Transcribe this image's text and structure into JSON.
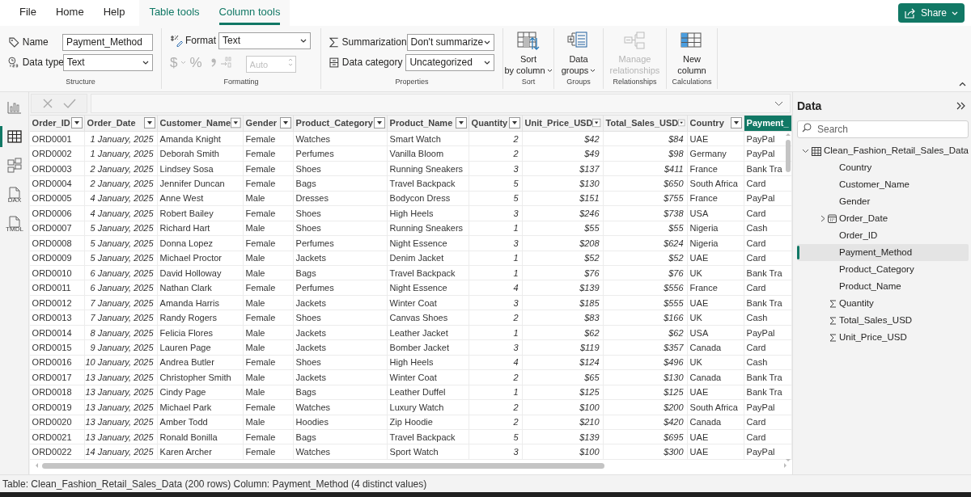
{
  "menu_tabs": [
    {
      "label": "File",
      "selected": false,
      "contextual": false
    },
    {
      "label": "Home",
      "selected": false,
      "contextual": false
    },
    {
      "label": "Help",
      "selected": false,
      "contextual": false
    },
    {
      "label": "Table tools",
      "selected": false,
      "contextual": true
    },
    {
      "label": "Column tools",
      "selected": true,
      "contextual": true
    }
  ],
  "share_button": "Share",
  "structure": {
    "name_label": "Name",
    "name_value": "Payment_Method",
    "data_type_label": "Data type",
    "data_type_value": "Text",
    "group_label": "Structure"
  },
  "formatting": {
    "format_label": "Format",
    "format_value": "Text",
    "currency_symbol": "$",
    "percent_symbol": "%",
    "decimal_placeholder": "Auto",
    "disabled": true,
    "group_label": "Formatting"
  },
  "properties": {
    "summarization_label": "Summarization",
    "summarization_value": "Don't summarize",
    "category_label": "Data category",
    "category_value": "Uncategorized",
    "group_label": "Properties"
  },
  "ribbon_buttons": [
    {
      "kind": "sort",
      "label": "Sort by column",
      "dropdown": true,
      "disabled": false,
      "group_label": "Sort"
    },
    {
      "kind": "groups",
      "label": "Data groups",
      "dropdown": true,
      "disabled": false,
      "group_label": "Groups"
    },
    {
      "kind": "relationships",
      "label": "Manage relationships",
      "dropdown": false,
      "disabled": true,
      "group_label": "Relationships"
    },
    {
      "kind": "new_column",
      "label": "New column",
      "dropdown": false,
      "disabled": false,
      "group_label": "Calculations"
    }
  ],
  "nav": [
    {
      "kind": "report",
      "selected": false
    },
    {
      "kind": "table",
      "selected": true
    },
    {
      "kind": "model",
      "selected": false
    },
    {
      "kind": "dax",
      "badge": "DAX",
      "selected": false
    },
    {
      "kind": "tmdl",
      "badge": "TMDL",
      "selected": false
    }
  ],
  "table": {
    "columns": [
      {
        "name": "Order_ID",
        "kind": "text",
        "selected": false,
        "filter": true
      },
      {
        "name": "Order_Date",
        "kind": "date",
        "selected": false,
        "filter": true
      },
      {
        "name": "Customer_Name",
        "kind": "text",
        "selected": false,
        "filter": true
      },
      {
        "name": "Gender",
        "kind": "text",
        "selected": false,
        "filter": true
      },
      {
        "name": "Product_Category",
        "kind": "text",
        "selected": false,
        "filter": true
      },
      {
        "name": "Product_Name",
        "kind": "text",
        "selected": false,
        "filter": true
      },
      {
        "name": "Quantity",
        "kind": "number",
        "selected": false,
        "filter": true
      },
      {
        "name": "Unit_Price_USD",
        "kind": "number",
        "selected": false,
        "filter": true
      },
      {
        "name": "Total_Sales_USD",
        "kind": "number",
        "selected": false,
        "filter": true
      },
      {
        "name": "Country",
        "kind": "text",
        "selected": false,
        "filter": true
      },
      {
        "name": "Payment_",
        "kind": "text",
        "selected": true,
        "filter": false
      }
    ],
    "rows": [
      [
        "ORD0001",
        "1 January, 2025",
        "Amanda Knight",
        "Female",
        "Watches",
        "Smart Watch",
        "2",
        "$42",
        "$84",
        "UAE",
        "PayPal"
      ],
      [
        "ORD0002",
        "1 January, 2025",
        "Deborah Smith",
        "Female",
        "Perfumes",
        "Vanilla Bloom",
        "2",
        "$49",
        "$98",
        "Germany",
        "PayPal"
      ],
      [
        "ORD0003",
        "2 January, 2025",
        "Lindsey Sosa",
        "Female",
        "Shoes",
        "Running Sneakers",
        "3",
        "$137",
        "$411",
        "France",
        "Bank Tra"
      ],
      [
        "ORD0004",
        "2 January, 2025",
        "Jennifer Duncan",
        "Female",
        "Bags",
        "Travel Backpack",
        "5",
        "$130",
        "$650",
        "South Africa",
        "Card"
      ],
      [
        "ORD0005",
        "4 January, 2025",
        "Anne West",
        "Male",
        "Dresses",
        "Bodycon Dress",
        "5",
        "$151",
        "$755",
        "France",
        "PayPal"
      ],
      [
        "ORD0006",
        "4 January, 2025",
        "Robert Bailey",
        "Female",
        "Shoes",
        "High Heels",
        "3",
        "$246",
        "$738",
        "USA",
        "Card"
      ],
      [
        "ORD0007",
        "5 January, 2025",
        "Richard Hart",
        "Male",
        "Shoes",
        "Running Sneakers",
        "1",
        "$55",
        "$55",
        "Nigeria",
        "Cash"
      ],
      [
        "ORD0008",
        "5 January, 2025",
        "Donna Lopez",
        "Female",
        "Perfumes",
        "Night Essence",
        "3",
        "$208",
        "$624",
        "Nigeria",
        "Card"
      ],
      [
        "ORD0009",
        "5 January, 2025",
        "Michael Proctor",
        "Male",
        "Jackets",
        "Denim Jacket",
        "1",
        "$52",
        "$52",
        "UAE",
        "Card"
      ],
      [
        "ORD0010",
        "6 January, 2025",
        "David Holloway",
        "Male",
        "Bags",
        "Travel Backpack",
        "1",
        "$76",
        "$76",
        "UK",
        "Bank Tra"
      ],
      [
        "ORD0011",
        "6 January, 2025",
        "Nathan Clark",
        "Female",
        "Perfumes",
        "Night Essence",
        "4",
        "$139",
        "$556",
        "France",
        "Card"
      ],
      [
        "ORD0012",
        "7 January, 2025",
        "Amanda Harris",
        "Male",
        "Jackets",
        "Winter Coat",
        "3",
        "$185",
        "$555",
        "UAE",
        "Bank Tra"
      ],
      [
        "ORD0013",
        "7 January, 2025",
        "Randy Rogers",
        "Female",
        "Shoes",
        "Canvas Shoes",
        "2",
        "$83",
        "$166",
        "UK",
        "Cash"
      ],
      [
        "ORD0014",
        "8 January, 2025",
        "Felicia Flores",
        "Male",
        "Jackets",
        "Leather Jacket",
        "1",
        "$62",
        "$62",
        "USA",
        "PayPal"
      ],
      [
        "ORD0015",
        "9 January, 2025",
        "Lauren Page",
        "Male",
        "Jackets",
        "Bomber Jacket",
        "3",
        "$119",
        "$357",
        "Canada",
        "Card"
      ],
      [
        "ORD0016",
        "10 January, 2025",
        "Andrea Butler",
        "Female",
        "Shoes",
        "High Heels",
        "4",
        "$124",
        "$496",
        "UK",
        "Cash"
      ],
      [
        "ORD0017",
        "13 January, 2025",
        "Christopher Smith",
        "Male",
        "Jackets",
        "Winter Coat",
        "2",
        "$65",
        "$130",
        "Canada",
        "Bank Tra"
      ],
      [
        "ORD0018",
        "13 January, 2025",
        "Cindy Page",
        "Male",
        "Bags",
        "Leather Duffel",
        "1",
        "$125",
        "$125",
        "UAE",
        "Bank Tra"
      ],
      [
        "ORD0019",
        "13 January, 2025",
        "Michael Park",
        "Female",
        "Watches",
        "Luxury Watch",
        "2",
        "$100",
        "$200",
        "South Africa",
        "PayPal"
      ],
      [
        "ORD0020",
        "13 January, 2025",
        "Amber Todd",
        "Male",
        "Hoodies",
        "Zip Hoodie",
        "2",
        "$210",
        "$420",
        "Canada",
        "Card"
      ],
      [
        "ORD0021",
        "13 January, 2025",
        "Ronald Bonilla",
        "Female",
        "Bags",
        "Travel Backpack",
        "5",
        "$139",
        "$695",
        "UAE",
        "Card"
      ],
      [
        "ORD0022",
        "14 January, 2025",
        "Karen Archer",
        "Female",
        "Watches",
        "Sport Watch",
        "3",
        "$100",
        "$300",
        "UAE",
        "PayPal"
      ]
    ]
  },
  "data_pane": {
    "title": "Data",
    "search_placeholder": "Search",
    "table_name": "Clean_Fashion_Retail_Sales_Data",
    "expanded": true,
    "fields": [
      {
        "name": "Country",
        "kind": "text",
        "selected": false
      },
      {
        "name": "Customer_Name",
        "kind": "text",
        "selected": false
      },
      {
        "name": "Gender",
        "kind": "text",
        "selected": false
      },
      {
        "name": "Order_Date",
        "kind": "date",
        "selected": false,
        "expanded": false
      },
      {
        "name": "Order_ID",
        "kind": "text",
        "selected": false
      },
      {
        "name": "Payment_Method",
        "kind": "text",
        "selected": true
      },
      {
        "name": "Product_Category",
        "kind": "text",
        "selected": false
      },
      {
        "name": "Product_Name",
        "kind": "text",
        "selected": false
      },
      {
        "name": "Quantity",
        "kind": "sum",
        "selected": false
      },
      {
        "name": "Total_Sales_USD",
        "kind": "sum",
        "selected": false
      },
      {
        "name": "Unit_Price_USD",
        "kind": "sum",
        "selected": false
      }
    ]
  },
  "status_bar": "Table: Clean_Fashion_Retail_Sales_Data (200 rows) Column: Payment_Method (4 distinct values)"
}
